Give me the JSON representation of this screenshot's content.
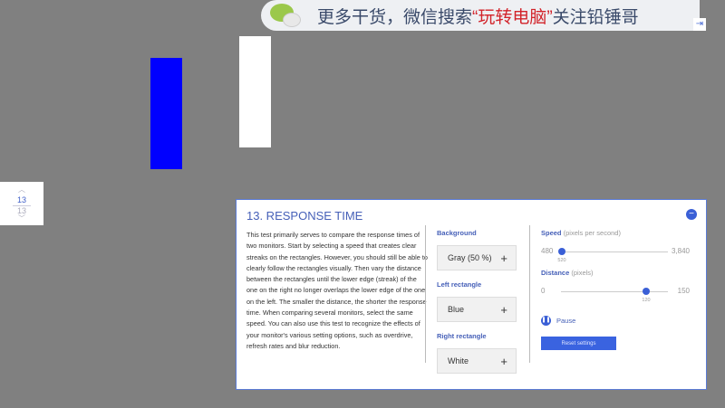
{
  "banner": {
    "text_before": "更多干货，微信搜索",
    "highlight": "“玩转电脑”",
    "text_after": "关注铅锤哥"
  },
  "nav": {
    "current": "13",
    "total": "13"
  },
  "panel": {
    "title": "13. RESPONSE TIME",
    "description": "This test primarily serves to compare the response times of two monitors. Start by selecting a speed that creates clear streaks on the rectangles. However, you should still be able to clearly follow the rectangles visually. Then vary the distance between the rectangles until the lower edge (streak) of the one on the right no longer overlaps the lower edge of the one on the left. The smaller the distance, the shorter the response time. When comparing several monitors, select the same speed. You can also use this test to recognize the effects of your monitor's various setting options, such as overdrive, refresh rates and blur reduction.",
    "background": {
      "label": "Background",
      "value": "Gray (50 %)"
    },
    "left_rect": {
      "label": "Left rectangle",
      "value": "Blue"
    },
    "right_rect": {
      "label": "Right rectangle",
      "value": "White"
    },
    "speed": {
      "label": "Speed",
      "unit": "(pixels per second)",
      "min": "480",
      "max": "3,840",
      "value": "520",
      "fraction": 0.012
    },
    "distance": {
      "label": "Distance",
      "unit": "(pixels)",
      "min": "0",
      "max": "150",
      "value": "120",
      "fraction": 0.8
    },
    "pause_label": "Pause",
    "reset_label": "Reset settings"
  },
  "colors": {
    "accent": "#3a5fd6",
    "left_rect": "#0000ff",
    "right_rect": "#ffffff",
    "background": "#808080"
  }
}
